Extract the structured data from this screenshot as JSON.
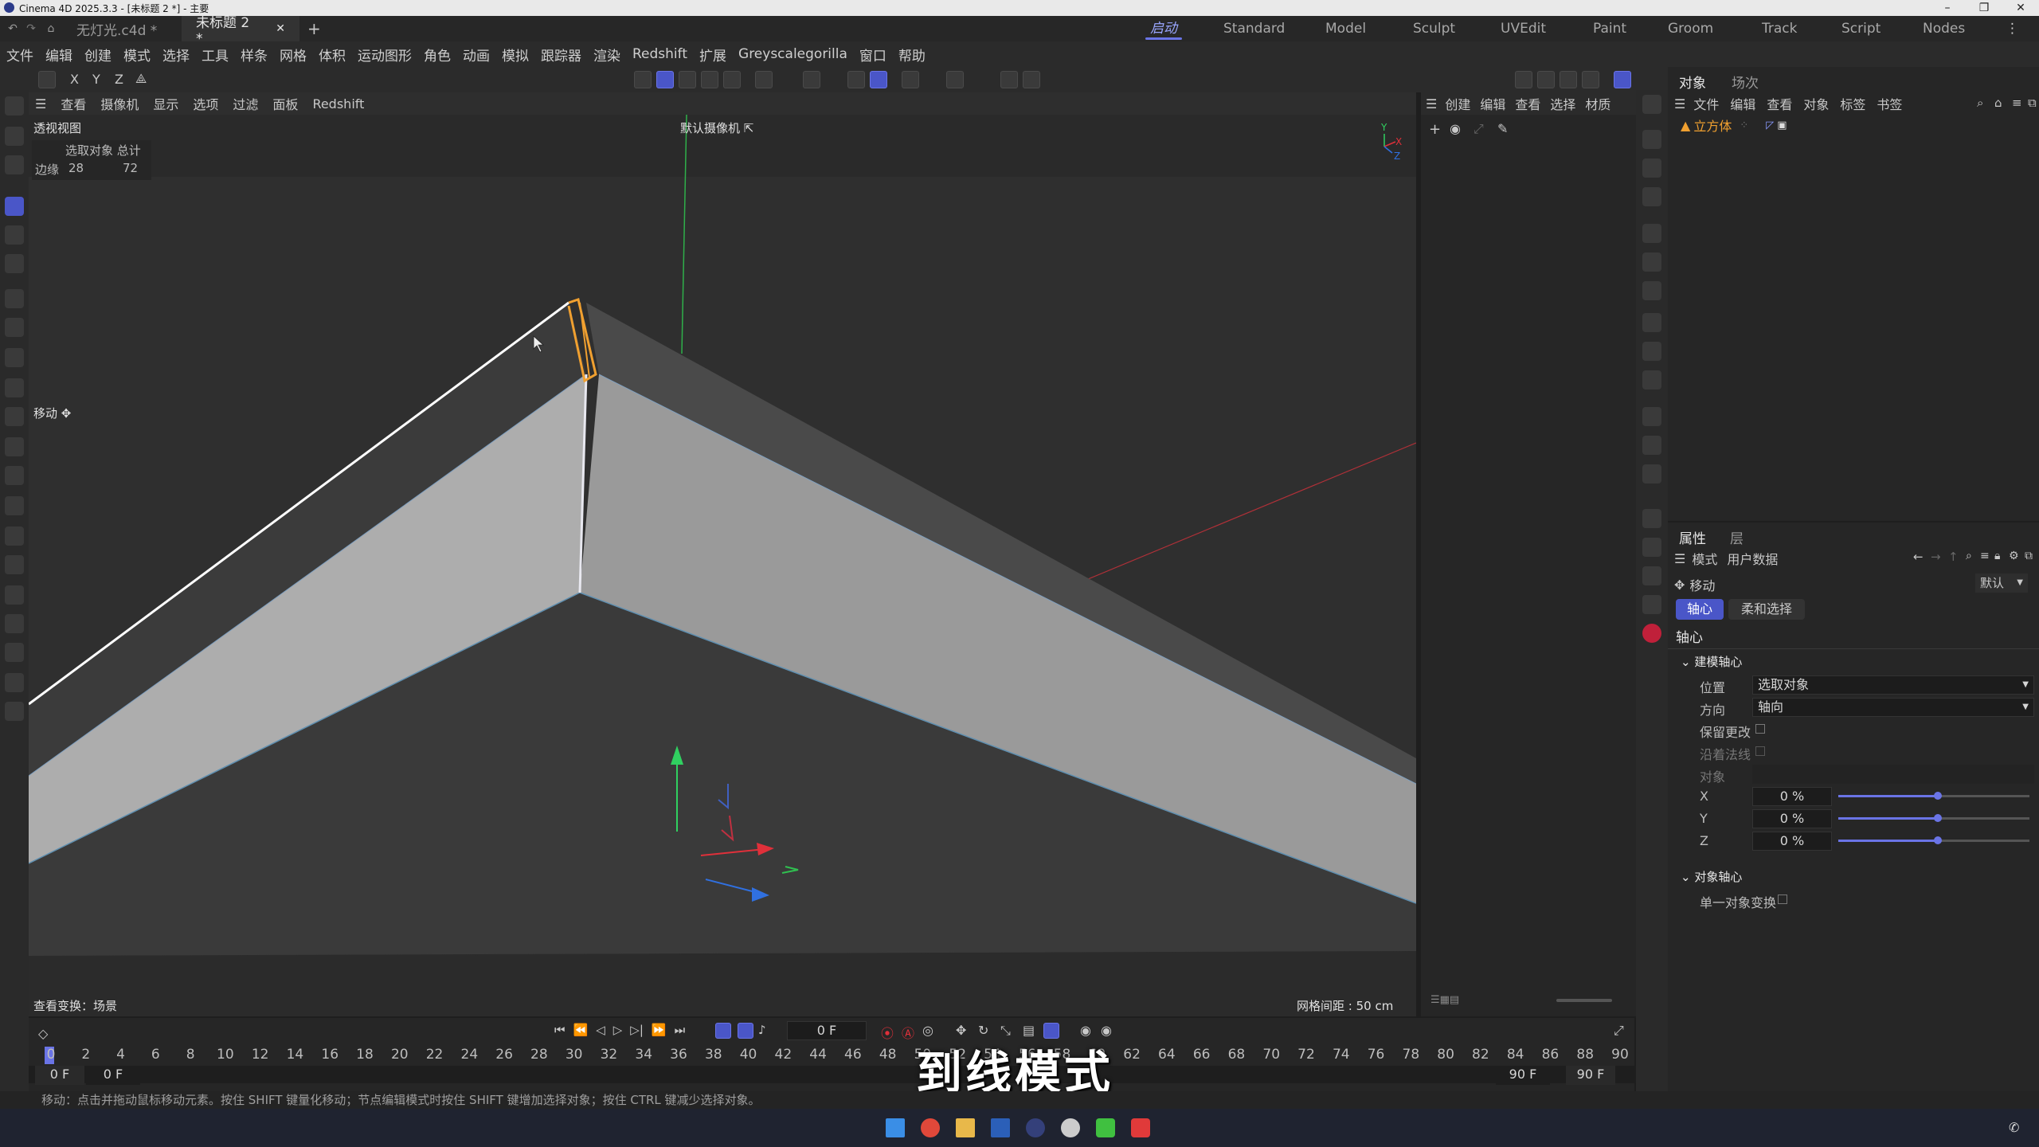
{
  "window": {
    "title": "Cinema 4D 2025.3.3 - [未标题 2 *] - 主要"
  },
  "tabs": [
    {
      "label": "无灯光.c4d *"
    },
    {
      "label": "未标题 2 *"
    }
  ],
  "layouts": [
    "启动",
    "Standard",
    "Model",
    "Sculpt",
    "UVEdit",
    "Paint",
    "Groom",
    "Track",
    "Script",
    "Nodes"
  ],
  "menu": [
    "文件",
    "编辑",
    "创建",
    "模式",
    "选择",
    "工具",
    "样条",
    "网格",
    "体积",
    "运动图形",
    "角色",
    "动画",
    "模拟",
    "跟踪器",
    "渲染",
    "Redshift",
    "扩展",
    "Greyscalegorilla",
    "窗口",
    "帮助"
  ],
  "axis_lock": [
    "X",
    "Y",
    "Z"
  ],
  "viewport": {
    "menu": [
      "查看",
      "摄像机",
      "显示",
      "选项",
      "过滤",
      "面板",
      "Redshift"
    ],
    "view_name": "透视视图",
    "camera": "默认摄像机",
    "hud_header": "选取对象 总计",
    "hud_row_label": "边缘",
    "hud_selected": "28",
    "hud_total": "72",
    "tool_label": "移动",
    "view_transform": "查看变换：场景",
    "grid_spacing": "网格间距 : 50 cm"
  },
  "mid_panel": {
    "menu": [
      "创建",
      "编辑",
      "查看",
      "选择",
      "材质"
    ]
  },
  "object_panel": {
    "tabs": [
      "对象",
      "场次"
    ],
    "menu": [
      "文件",
      "编辑",
      "查看",
      "对象",
      "标签",
      "书签"
    ],
    "items": [
      {
        "name": "立方体"
      }
    ]
  },
  "attributes": {
    "tabs": [
      "属性",
      "层"
    ],
    "menu": [
      "模式",
      "用户数据"
    ],
    "tool": "移动",
    "preset": "默认",
    "subtabs": [
      "轴心",
      "柔和选择"
    ],
    "section_title": "轴心",
    "group1": {
      "title": "建模轴心",
      "position_label": "位置",
      "position_value": "选取对象",
      "orientation_label": "方向",
      "orientation_value": "轴向",
      "keep_changes_label": "保留更改",
      "along_normals_label": "沿着法线",
      "object_label": "对象",
      "x_label": "X",
      "x_value": "0 %",
      "y_label": "Y",
      "y_value": "0 %",
      "z_label": "Z",
      "z_value": "0 %"
    },
    "group2": {
      "title": "对象轴心",
      "single_transform_label": "单一对象变换"
    }
  },
  "timeline": {
    "current_frame": "0 F",
    "start_field": "0 F",
    "start_field2": "0 F",
    "end_field": "90 F",
    "end_field2": "90 F",
    "ruler_ticks": [
      "0",
      "2",
      "4",
      "6",
      "8",
      "10",
      "12",
      "14",
      "16",
      "18",
      "20",
      "22",
      "24",
      "26",
      "28",
      "30",
      "32",
      "34",
      "36",
      "38",
      "40",
      "42",
      "44",
      "46",
      "48",
      "50",
      "52",
      "54",
      "56",
      "58",
      "60",
      "62",
      "64",
      "66",
      "68",
      "70",
      "72",
      "74",
      "76",
      "78",
      "80",
      "82",
      "84",
      "86",
      "88",
      "90"
    ]
  },
  "status_bar": "移动：点击并拖动鼠标移动元素。按住 SHIFT 键量化移动；节点编辑模式时按住 SHIFT 键增加选择对象；按住 CTRL 键减少选择对象。",
  "subtitle": "到线模式",
  "colors": {
    "accent": "#6a74e6",
    "object_orange": "#f0a030",
    "axis_red": "#e0303a",
    "axis_green": "#30d060",
    "axis_blue": "#3070e0"
  }
}
